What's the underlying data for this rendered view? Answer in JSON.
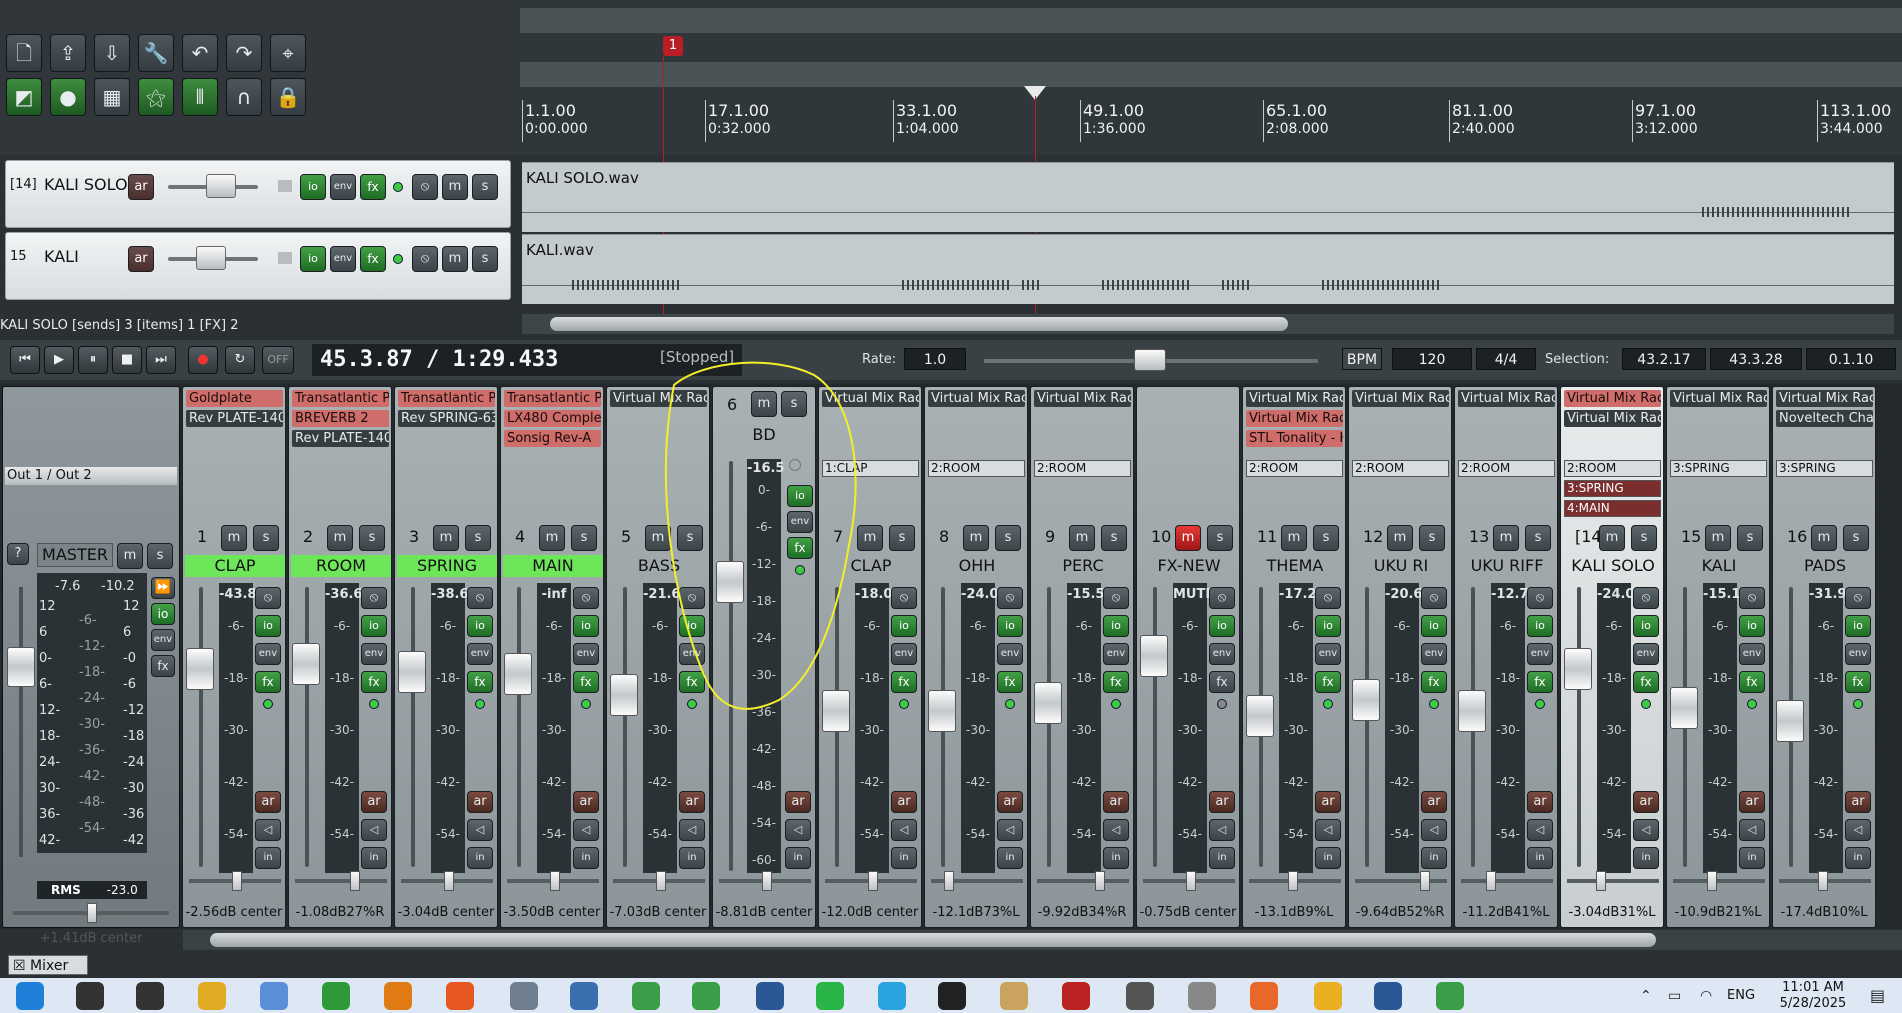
{
  "toolbar": {
    "icons": [
      "new-project-icon",
      "open-project-icon",
      "save-project-icon",
      "wrench-icon",
      "undo-icon",
      "redo-icon",
      "metronome-icon",
      "auto-crossfade-icon",
      "ripple-edit-icon",
      "grid-icon",
      "snap-icon",
      "item-lock-icon",
      "magnet-icon",
      "lock-icon"
    ]
  },
  "ruler": [
    {
      "bar": "1.1.00",
      "time": "0:00.000"
    },
    {
      "bar": "17.1.00",
      "time": "0:32.000"
    },
    {
      "bar": "33.1.00",
      "time": "1:04.000"
    },
    {
      "bar": "49.1.00",
      "time": "1:36.000"
    },
    {
      "bar": "65.1.00",
      "time": "2:08.000"
    },
    {
      "bar": "81.1.00",
      "time": "2:40.000"
    },
    {
      "bar": "97.1.00",
      "time": "3:12.000"
    },
    {
      "bar": "113.1.00",
      "time": "3:44.000"
    }
  ],
  "marker_label": "1",
  "tracks": [
    {
      "num": "[14]",
      "name": "KALI SOLO",
      "item": "KALI SOLO.wav"
    },
    {
      "num": "15",
      "name": "KALI",
      "item": "KALI.wav"
    }
  ],
  "track_buttons": {
    "ar": "ar",
    "io": "io",
    "env": "env",
    "fx": "fx",
    "m": "m",
    "s": "s"
  },
  "status_line": "KALI SOLO [sends] 3 [items] 1 [FX] 2",
  "transport": {
    "position": "45.3.87 / 1:29.433",
    "state": "[Stopped]",
    "rate_label": "Rate:",
    "rate": "1.0",
    "bpm_label": "BPM",
    "bpm": "120",
    "timesig": "4/4",
    "selection_label": "Selection:",
    "sel_start": "43.2.17",
    "sel_end": "43.3.28",
    "sel_len": "0.1.10",
    "off": "OFF"
  },
  "master": {
    "output": "Out 1 / Out 2",
    "label": "MASTER",
    "peak_l": "-7.6",
    "peak_r": "-10.2",
    "scale": [
      "12",
      "6",
      "0-",
      "6-",
      "12-",
      "18-",
      "24-",
      "30-",
      "36-",
      "42-"
    ],
    "scale_mid": [
      "-6-",
      "-12-",
      "-18-",
      "-24-",
      "-30-",
      "-36-",
      "-42-",
      "-48-",
      "-54-"
    ],
    "scale_right": [
      "12",
      "6",
      "-0",
      "-6",
      "-12",
      "-18",
      "-24",
      "-30",
      "-36",
      "-42"
    ],
    "rms_label": "RMS",
    "rms": "-23.0",
    "foot": "+1.41dB center",
    "help": "?"
  },
  "mixer_tab": "Mixer",
  "strips": [
    {
      "num": "1",
      "name": "CLAP",
      "green": true,
      "fx": [
        {
          "t": "Goldplate",
          "red": true
        },
        {
          "t": "Rev PLATE-140",
          "red": false
        }
      ],
      "sends": [],
      "peak": "-43.8",
      "foot": "-2.56dB center",
      "fader": 0.62,
      "pan": 0.5
    },
    {
      "num": "2",
      "name": "ROOM",
      "green": true,
      "fx": [
        {
          "t": "Transatlantic Pl",
          "red": true
        },
        {
          "t": "BREVERB 2",
          "red": true
        },
        {
          "t": "Rev PLATE-140",
          "red": false
        }
      ],
      "sends": [],
      "peak": "-36.6",
      "foot": "-1.08dB27%R",
      "fader": 0.6,
      "pan": 0.64
    },
    {
      "num": "3",
      "name": "SPRING",
      "green": true,
      "fx": [
        {
          "t": "Transatlantic Pla",
          "red": true
        },
        {
          "t": "Rev SPRING-636",
          "red": false
        }
      ],
      "sends": [],
      "peak": "-38.6",
      "foot": "-3.04dB center",
      "fader": 0.63,
      "pan": 0.5
    },
    {
      "num": "4",
      "name": "MAIN",
      "green": true,
      "fx": [
        {
          "t": "Transatlantic Pl",
          "red": true
        },
        {
          "t": "LX480 Complet",
          "red": true
        },
        {
          "t": "Sonsig Rev-A",
          "red": true
        }
      ],
      "sends": [],
      "peak": "-inf",
      "foot": "-3.50dB center",
      "fader": 0.64,
      "pan": 0.5
    },
    {
      "num": "5",
      "name": "BASS",
      "green": false,
      "fx": [
        {
          "t": "Virtual Mix Rack",
          "red": false
        }
      ],
      "sends": [],
      "peak": "-21.6",
      "foot": "-7.03dB center",
      "fader": 0.72,
      "pan": 0.5
    },
    {
      "num": "6",
      "name": "BD",
      "green": false,
      "fx": [],
      "sends": [],
      "peak": "-16.5",
      "foot": "-8.81dB center",
      "fader": 0.58,
      "pan": 0.5,
      "bd": true
    },
    {
      "num": "7",
      "name": "CLAP",
      "green": false,
      "fx": [
        {
          "t": "Virtual Mix Rack",
          "red": false
        }
      ],
      "sends": [
        {
          "t": "1:CLAP",
          "red": false
        }
      ],
      "peak": "-18.0",
      "foot": "-12.0dB center",
      "fader": 0.78,
      "pan": 0.5
    },
    {
      "num": "8",
      "name": "OHH",
      "green": false,
      "fx": [
        {
          "t": "Virtual Mix Rack",
          "red": false
        }
      ],
      "sends": [
        {
          "t": "2:ROOM",
          "red": false
        }
      ],
      "peak": "-24.0",
      "foot": "-12.1dB73%L",
      "fader": 0.78,
      "pan": 0.15
    },
    {
      "num": "9",
      "name": "PERC",
      "green": false,
      "fx": [
        {
          "t": "Virtual Mix Rack",
          "red": false
        }
      ],
      "sends": [
        {
          "t": "2:ROOM",
          "red": false
        }
      ],
      "peak": "-15.5",
      "foot": "-9.92dB34%R",
      "fader": 0.75,
      "pan": 0.67
    },
    {
      "num": "10",
      "name": "FX-NEW",
      "green": false,
      "fx": [],
      "sends": [],
      "peak": "MUTE",
      "foot": "-0.75dB center",
      "fader": 0.57,
      "pan": 0.5,
      "mute": true
    },
    {
      "num": "11",
      "name": "THEMA",
      "green": false,
      "fx": [
        {
          "t": "Virtual Mix Rack",
          "red": false
        },
        {
          "t": "Virtual Mix Rac",
          "red": true
        },
        {
          "t": "STL Tonality - H",
          "red": true
        }
      ],
      "sends": [
        {
          "t": "2:ROOM",
          "red": false
        }
      ],
      "peak": "-17.2",
      "foot": "-13.1dB9%L",
      "fader": 0.8,
      "pan": 0.45
    },
    {
      "num": "12",
      "name": "UKU RI",
      "green": false,
      "fx": [
        {
          "t": "Virtual Mix Rack",
          "red": false
        }
      ],
      "sends": [
        {
          "t": "2:ROOM",
          "red": false
        }
      ],
      "peak": "-20.6",
      "foot": "-9.64dB52%R",
      "fader": 0.74,
      "pan": 0.76
    },
    {
      "num": "13",
      "name": "UKU RIFF",
      "green": false,
      "fx": [
        {
          "t": "Virtual Mix Rack",
          "red": false
        }
      ],
      "sends": [
        {
          "t": "2:ROOM",
          "red": false
        }
      ],
      "peak": "-12.7",
      "foot": "-11.2dB41%L",
      "fader": 0.78,
      "pan": 0.29
    },
    {
      "num": "[14]",
      "name": "KALI SOLO",
      "green": false,
      "sel": true,
      "fx": [
        {
          "t": "Virtual Mix Rack",
          "red": true
        },
        {
          "t": "Virtual Mix Rack",
          "red": false
        }
      ],
      "sends": [
        {
          "t": "2:ROOM",
          "red": false
        },
        {
          "t": "3:SPRING",
          "red": true
        },
        {
          "t": "4:MAIN",
          "red": true
        }
      ],
      "peak": "-24.0",
      "foot": "-3.04dB31%L",
      "fader": 0.62,
      "pan": 0.34
    },
    {
      "num": "15",
      "name": "KALI",
      "green": false,
      "fx": [
        {
          "t": "Virtual Mix Rack",
          "red": false
        }
      ],
      "sends": [
        {
          "t": "3:SPRING",
          "red": false
        }
      ],
      "peak": "-15.1",
      "foot": "-10.9dB21%L",
      "fader": 0.77,
      "pan": 0.39
    },
    {
      "num": "16",
      "name": "PADS",
      "green": false,
      "fx": [
        {
          "t": "Virtual Mix Rack",
          "red": false
        },
        {
          "t": "Noveltech Chara",
          "red": false
        }
      ],
      "sends": [
        {
          "t": "3:SPRING",
          "red": false
        }
      ],
      "peak": "-31.9",
      "foot": "-17.4dB10%L",
      "fader": 0.82,
      "pan": 0.45
    }
  ],
  "scale": [
    "-6-",
    "-18-",
    "-30-",
    "-42-",
    "-54-"
  ],
  "bd_scale": [
    "0-",
    "-6-",
    "-12-",
    "-18-",
    "-24-",
    "-30-",
    "-36-",
    "-42-",
    "-48-",
    "-54-",
    "-60-"
  ],
  "taskbar": {
    "lang": "ENG",
    "time": "11:01 AM",
    "date": "5/28/2025",
    "apps": [
      {
        "n": "start-icon",
        "c": "#1f7fd9"
      },
      {
        "n": "search-icon",
        "c": "#333"
      },
      {
        "n": "task-view-icon",
        "c": "#333"
      },
      {
        "n": "file-explorer-icon",
        "c": "#e2a922"
      },
      {
        "n": "paint-icon",
        "c": "#5a8fd8"
      },
      {
        "n": "utorrent-icon",
        "c": "#2e9a39"
      },
      {
        "n": "vlc-icon",
        "c": "#e07a13"
      },
      {
        "n": "firefox-icon",
        "c": "#e6581f"
      },
      {
        "n": "kleopatra-icon",
        "c": "#6f7f8f"
      },
      {
        "n": "photos-icon",
        "c": "#3c6fb0"
      },
      {
        "n": "chrome-icon",
        "c": "#3a9d47"
      },
      {
        "n": "chrome-2-icon",
        "c": "#3a9d47"
      },
      {
        "n": "word-icon",
        "c": "#2b5797"
      },
      {
        "n": "whatsapp-icon",
        "c": "#28b446"
      },
      {
        "n": "telegram-icon",
        "c": "#2aa3df"
      },
      {
        "n": "audio-app-icon",
        "c": "#222"
      },
      {
        "n": "moon-app-icon",
        "c": "#caa35e"
      },
      {
        "n": "reaper-icon",
        "c": "#b22"
      },
      {
        "n": "settings-icon",
        "c": "#555"
      },
      {
        "n": "scanner-icon",
        "c": "#888"
      },
      {
        "n": "spectrum-icon",
        "c": "#e8682c"
      },
      {
        "n": "pdf-icon",
        "c": "#e8b020"
      },
      {
        "n": "word-2-icon",
        "c": "#2b5797"
      },
      {
        "n": "chrome-3-icon",
        "c": "#3a9d47"
      }
    ]
  }
}
